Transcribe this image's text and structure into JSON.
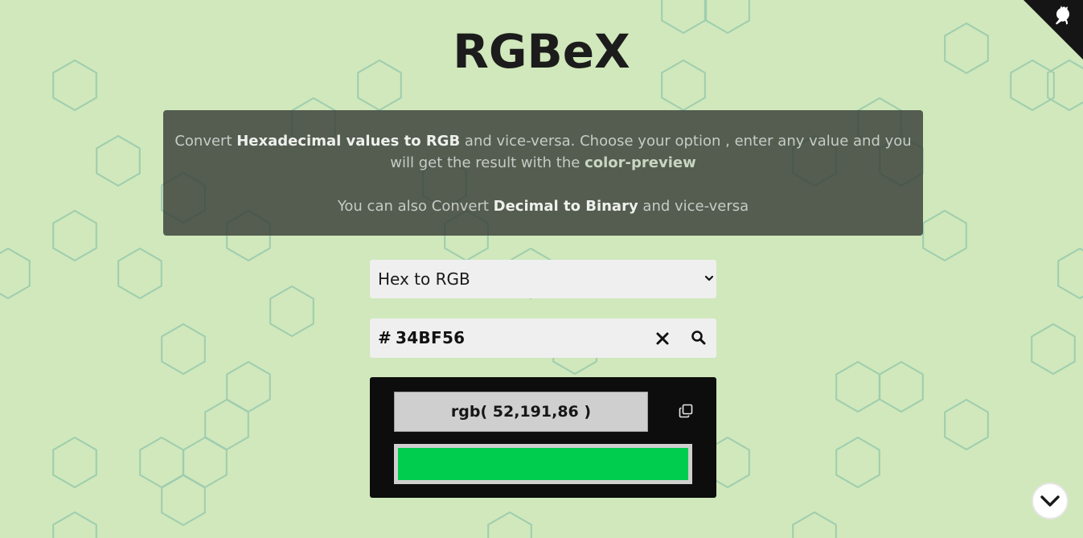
{
  "app": {
    "title": "RGBeX"
  },
  "info": {
    "line1_prefix": "Convert ",
    "line1_bold": "Hexadecimal values to RGB",
    "line1_mid": " and vice-versa. Choose your option , enter any value and you will get the result with the ",
    "line1_accent": "color-preview",
    "line2_prefix": "You can also Convert ",
    "line2_bold": "Decimal to Binary",
    "line2_suffix": " and vice-versa"
  },
  "converter": {
    "mode_selected": "Hex to RGB",
    "input_prefix": "#",
    "input_value": "34BF56"
  },
  "result": {
    "rgb_text": "rgb( 52,191,86 )",
    "preview_color": "#00CC4D"
  },
  "icons": {
    "github": "github-octocat-icon",
    "clear": "close-x-icon",
    "search": "search-icon",
    "copy": "copy-icon",
    "scroll": "chevron-down-icon",
    "select": "chevron-down-icon"
  },
  "colors": {
    "background": "#D0E8BB",
    "hex_outline": "#9FCDB0",
    "info_box": "#383E38",
    "panel": "#0D0D0D"
  }
}
